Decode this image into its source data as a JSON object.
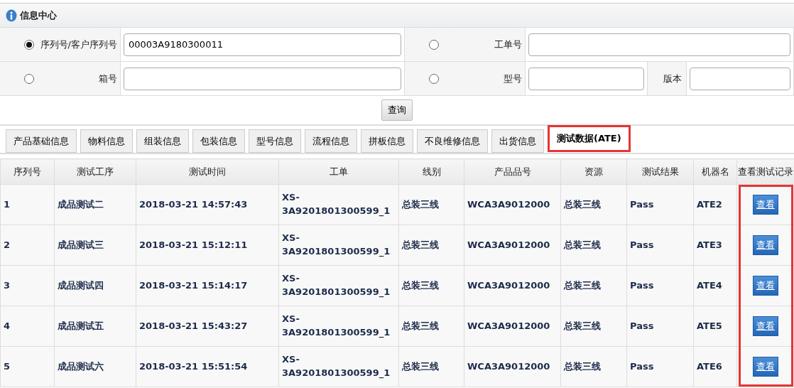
{
  "panel": {
    "title": "信息中心"
  },
  "search": {
    "fields": [
      {
        "label": "序列号/客户序列号",
        "selected": true,
        "value": "00003A9180300011"
      },
      {
        "label": "工单号",
        "selected": false
      },
      {
        "label": "箱号",
        "selected": false
      },
      {
        "label": "型号",
        "selected": false,
        "extra_label": "版本"
      }
    ],
    "button": "查询"
  },
  "tabs": [
    {
      "label": "产品基础信息",
      "selected": false
    },
    {
      "label": "物料信息",
      "selected": false
    },
    {
      "label": "组装信息",
      "selected": false
    },
    {
      "label": "包装信息",
      "selected": false
    },
    {
      "label": "型号信息",
      "selected": false
    },
    {
      "label": "流程信息",
      "selected": false
    },
    {
      "label": "拼板信息",
      "selected": false
    },
    {
      "label": "不良维修信息",
      "selected": false
    },
    {
      "label": "出货信息",
      "selected": false
    },
    {
      "label": "测试数据(ATE)",
      "selected": true
    }
  ],
  "table": {
    "columns": [
      {
        "label": "序列号",
        "highlighted": false
      },
      {
        "label": "测试工序",
        "highlighted": false
      },
      {
        "label": "测试时间",
        "highlighted": false
      },
      {
        "label": "工单",
        "highlighted": false
      },
      {
        "label": "线别",
        "highlighted": false
      },
      {
        "label": "产品品号",
        "highlighted": false
      },
      {
        "label": "资源",
        "highlighted": false
      },
      {
        "label": "测试结果",
        "highlighted": false
      },
      {
        "label": "机器名",
        "highlighted": false
      },
      {
        "label": "查看测试记录",
        "highlighted": true
      }
    ],
    "rows": [
      {
        "cells": [
          "1",
          "成品测试二",
          "2018-03-21 14:57:43",
          "XS-3A9201801300599_1",
          "总装三线",
          "WCA3A9012000",
          "总装三线",
          "Pass",
          "ATE2"
        ],
        "action": "查看"
      },
      {
        "cells": [
          "2",
          "成品测试三",
          "2018-03-21 15:12:11",
          "XS-3A9201801300599_1",
          "总装三线",
          "WCA3A9012000",
          "总装三线",
          "Pass",
          "ATE3"
        ],
        "action": "查看"
      },
      {
        "cells": [
          "3",
          "成品测试四",
          "2018-03-21 15:14:17",
          "XS-3A9201801300599_1",
          "总装三线",
          "WCA3A9012000",
          "总装三线",
          "Pass",
          "ATE4"
        ],
        "action": "查看"
      },
      {
        "cells": [
          "4",
          "成品测试五",
          "2018-03-21 15:43:27",
          "XS-3A9201801300599_1",
          "总装三线",
          "WCA3A9012000",
          "总装三线",
          "Pass",
          "ATE5"
        ],
        "action": "查看"
      },
      {
        "cells": [
          "5",
          "成品测试六",
          "2018-03-21 15:51:54",
          "XS-3A9201801300599_1",
          "总装三线",
          "WCA3A9012000",
          "总装三线",
          "Pass",
          "ATE6"
        ],
        "action": "查看"
      }
    ]
  }
}
